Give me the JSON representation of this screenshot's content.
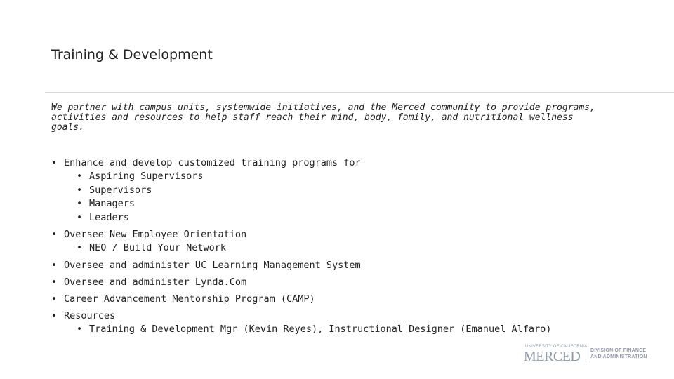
{
  "slide": {
    "title": "Training & Development",
    "intro": "We partner with campus units, systemwide initiatives, and the Merced community to provide programs, activities and resources to help staff reach their mind, body, family, and nutritional wellness goals.",
    "bullet_char": "•",
    "bullets": [
      {
        "text": "Enhance and develop customized training programs for",
        "sub": [
          "Aspiring Supervisors",
          "Supervisors",
          "Managers",
          "Leaders"
        ]
      },
      {
        "text": "Oversee New Employee Orientation",
        "sub": [
          "NEO / Build Your Network"
        ]
      },
      {
        "text": "Oversee and administer UC Learning Management System",
        "sub": []
      },
      {
        "text": "Oversee and administer Lynda.Com",
        "sub": []
      },
      {
        "text": "Career Advancement Mentorship Program (CAMP)",
        "sub": []
      },
      {
        "text": "Resources",
        "sub": [
          "Training & Development Mgr (Kevin Reyes), Instructional Designer (Emanuel Alfaro)"
        ]
      }
    ]
  },
  "logo": {
    "university": "UNIVERSITY OF CALIFORNIA",
    "campus": "MERCED",
    "division_line1": "DIVISION OF FINANCE",
    "division_line2": "AND ADMINISTRATION",
    "color": "#8e98a6"
  }
}
